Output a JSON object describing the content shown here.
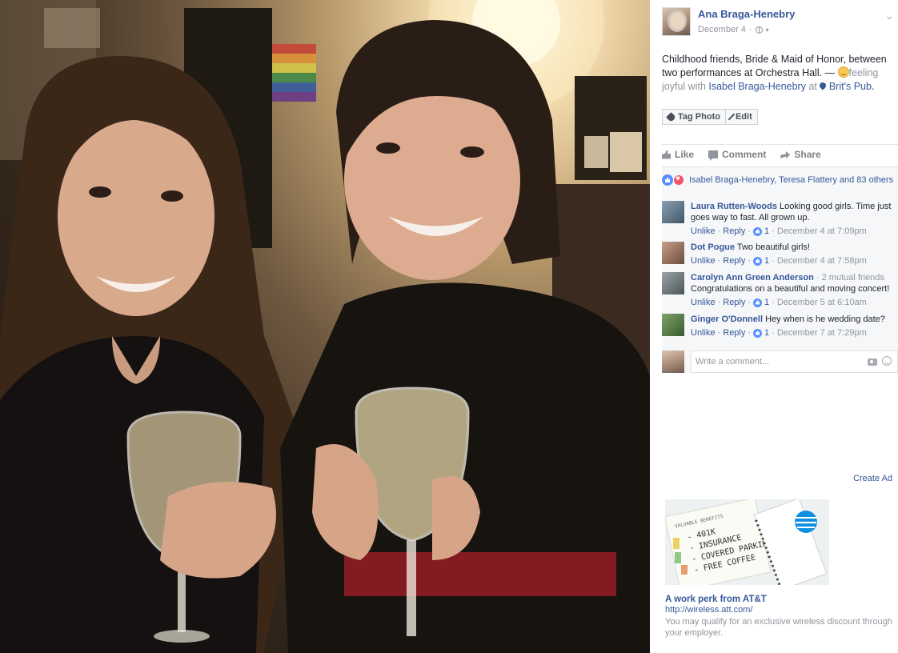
{
  "post": {
    "author": "Ana Braga-Henebry",
    "date": "December 4",
    "separator": "·",
    "caret": "▾",
    "menu_caret": "⌄",
    "text_main": "Childhood friends, Bride & Maid of Honor, between two performances at Orchestra Hall.",
    "text_dash": " — ",
    "feeling": "feeling joyful",
    "with_word": " with ",
    "tagged_person": "Isabel Braga-Henebry",
    "at_word": " at ",
    "place": "Brit's Pub",
    "period": ".",
    "tag_photo_label": "Tag Photo",
    "edit_label": "Edit"
  },
  "actions": {
    "like": "Like",
    "comment": "Comment",
    "share": "Share"
  },
  "reactions": {
    "summary": "Isabel Braga-Henebry, Teresa Flattery and 83 others"
  },
  "comments": [
    {
      "name": "Laura Rutten-Woods",
      "mutual": "",
      "text": "Looking good girls. Time just goes way to fast. All grown up.",
      "unlike": "Unlike",
      "reply": "Reply",
      "likes": "1",
      "time": "December 4 at 7:09pm"
    },
    {
      "name": "Dot Pogue",
      "mutual": "",
      "text": "Two beautiful girls!",
      "unlike": "Unlike",
      "reply": "Reply",
      "likes": "1",
      "time": "December 4 at 7:58pm"
    },
    {
      "name": "Carolyn Ann Green Anderson",
      "mutual": "· 2 mutual friends",
      "text": "Congratulations on a beautiful and moving concert!",
      "unlike": "Unlike",
      "reply": "Reply",
      "likes": "1",
      "time": "December 5 at 6:10am"
    },
    {
      "name": "Ginger O'Donnell",
      "mutual": "",
      "text": "Hey when is he wedding date?",
      "unlike": "Unlike",
      "reply": "Reply",
      "likes": "1",
      "time": "December 7 at 7:29pm"
    }
  ],
  "write_comment": {
    "placeholder": "Write a comment..."
  },
  "sidebar": {
    "create_ad": "Create Ad"
  },
  "ad": {
    "title": "A work perk from AT&T",
    "url": "http://wireless.att.com/",
    "description": "You may qualify for an exclusive wireless discount through your employer.",
    "image_header": "VALUABLE BENEFITS",
    "image_lines": [
      "- 401K",
      "- INSURANCE",
      "- COVERED PARKING",
      "- FREE COFFEE"
    ]
  },
  "colors": {
    "link": "#365899",
    "muted": "#90949c",
    "like_blue": "#5890ff",
    "love_red": "#f25268"
  }
}
